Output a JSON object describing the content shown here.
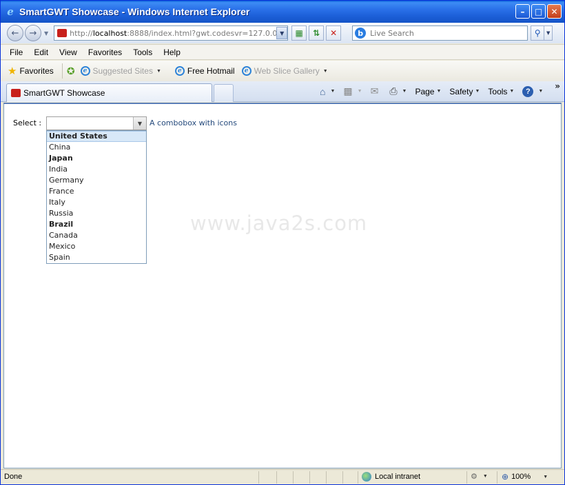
{
  "window": {
    "title": "SmartGWT Showcase - Windows Internet Explorer",
    "min_glyph": "–",
    "max_glyph": "□",
    "close_glyph": "✕"
  },
  "address": {
    "url_scheme": "http://",
    "url_host": "localhost",
    "url_rest": ":8888/index.html?gwt.codesvr=127.0.0.1:999"
  },
  "search": {
    "placeholder": "Live Search"
  },
  "menu": {
    "items": [
      "File",
      "Edit",
      "View",
      "Favorites",
      "Tools",
      "Help"
    ]
  },
  "favorites_bar": {
    "favorites_label": "Favorites",
    "links": [
      "Suggested Sites",
      "Free Hotmail",
      "Web Slice Gallery"
    ]
  },
  "tabs": {
    "active_tab": "SmartGWT Showcase"
  },
  "command_bar": {
    "page": "Page",
    "safety": "Safety",
    "tools": "Tools"
  },
  "content": {
    "select_label": "Select :",
    "combo_value": "",
    "hint": "A combobox with icons",
    "options": [
      {
        "label": "United States",
        "bold": true,
        "selected": true
      },
      {
        "label": "China",
        "bold": false,
        "selected": false
      },
      {
        "label": "Japan",
        "bold": true,
        "selected": false
      },
      {
        "label": "India",
        "bold": false,
        "selected": false
      },
      {
        "label": "Germany",
        "bold": false,
        "selected": false
      },
      {
        "label": "France",
        "bold": false,
        "selected": false
      },
      {
        "label": "Italy",
        "bold": false,
        "selected": false
      },
      {
        "label": "Russia",
        "bold": false,
        "selected": false
      },
      {
        "label": "Brazil",
        "bold": true,
        "selected": false
      },
      {
        "label": "Canada",
        "bold": false,
        "selected": false
      },
      {
        "label": "Mexico",
        "bold": false,
        "selected": false
      },
      {
        "label": "Spain",
        "bold": false,
        "selected": false
      }
    ],
    "watermark": "www.java2s.com"
  },
  "status_bar": {
    "status": "Done",
    "zone": "Local intranet",
    "zoom": "100%"
  }
}
